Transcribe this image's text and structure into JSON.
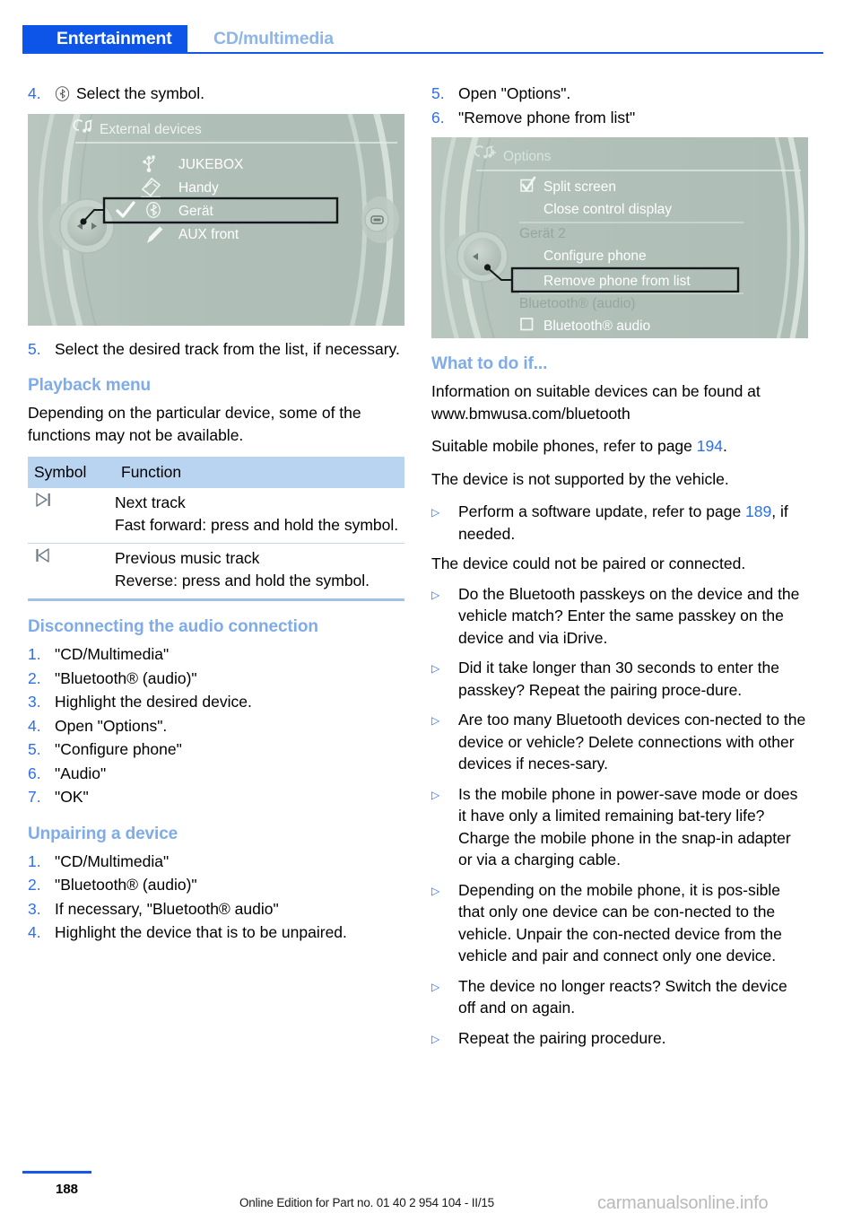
{
  "header": {
    "tab_active": "Entertainment",
    "tab_inactive": "CD/multimedia"
  },
  "left": {
    "step4": {
      "num": "4.",
      "icon": "bluetooth-circle-icon",
      "text": "Select the symbol."
    },
    "screenshot1": {
      "name": "external-devices-idrive-screen",
      "title": "External devices",
      "title_icon": "music-note-device-icon",
      "items": [
        {
          "label": "JUKEBOX",
          "icon": "usb-icon",
          "checked": false,
          "highlighted": false
        },
        {
          "label": "Handy",
          "icon": "handheld-device-icon",
          "checked": false,
          "highlighted": false
        },
        {
          "label": "Gerät",
          "icon": "bluetooth-icon",
          "checked": true,
          "highlighted": true
        },
        {
          "label": "AUX front",
          "icon": "aux-plug-icon",
          "checked": false,
          "highlighted": false
        }
      ]
    },
    "step5": {
      "num": "5.",
      "text": "Select the desired track from the list, if necessary."
    },
    "playback": {
      "heading": "Playback menu",
      "intro": "Depending on the particular device, some of the functions may not be available.",
      "table": {
        "headers": [
          "Symbol",
          "Function"
        ],
        "rows": [
          {
            "symbol_icon": "next-track-icon",
            "lines": [
              "Next track",
              "Fast forward: press and hold the symbol."
            ]
          },
          {
            "symbol_icon": "previous-track-icon",
            "lines": [
              "Previous music track",
              "Reverse: press and hold the symbol."
            ]
          }
        ]
      }
    },
    "disconnecting": {
      "heading": "Disconnecting the audio connection",
      "steps": [
        {
          "num": "1.",
          "text": "\"CD/Multimedia\""
        },
        {
          "num": "2.",
          "text": "\"Bluetooth® (audio)\""
        },
        {
          "num": "3.",
          "text": "Highlight the desired device."
        },
        {
          "num": "4.",
          "text": "Open \"Options\"."
        },
        {
          "num": "5.",
          "text": "\"Configure phone\""
        },
        {
          "num": "6.",
          "text": "\"Audio\""
        },
        {
          "num": "7.",
          "text": "\"OK\""
        }
      ]
    },
    "unpairing": {
      "heading": "Unpairing a device",
      "steps": [
        {
          "num": "1.",
          "text": "\"CD/Multimedia\""
        },
        {
          "num": "2.",
          "text": "\"Bluetooth® (audio)\""
        },
        {
          "num": "3.",
          "text": "If necessary, \"Bluetooth® audio\""
        },
        {
          "num": "4.",
          "text": "Highlight the device that is to be unpaired."
        }
      ]
    }
  },
  "right": {
    "steps_top": [
      {
        "num": "5.",
        "text": "Open \"Options\"."
      },
      {
        "num": "6.",
        "text": "\"Remove phone from list\""
      }
    ],
    "screenshot2": {
      "name": "options-idrive-screen",
      "title": "Options",
      "title_icon": "options-music-icon",
      "items": [
        {
          "label": "Split screen",
          "box": "checked",
          "dim": false,
          "highlighted": false
        },
        {
          "label": "Close control display",
          "box": "none",
          "dim": false,
          "highlighted": false
        },
        {
          "label": "Gerät 2",
          "box": "none",
          "dim": true,
          "highlighted": false
        },
        {
          "label": "Configure phone",
          "box": "none",
          "dim": false,
          "highlighted": false
        },
        {
          "label": "Remove phone from list",
          "box": "none",
          "dim": false,
          "highlighted": true
        },
        {
          "label": "Bluetooth® (audio)",
          "box": "none",
          "dim": true,
          "highlighted": false
        },
        {
          "label": "Bluetooth® audio",
          "box": "unchecked",
          "dim": false,
          "highlighted": false
        }
      ]
    },
    "whattodo": {
      "heading": "What to do if...",
      "paras": [
        "Information on suitable devices can be found at www.bmwusa.com/bluetooth"
      ],
      "ref_line": {
        "before": "Suitable mobile phones, refer to page ",
        "page": "194",
        "after": "."
      },
      "case1": "The device is not supported by the vehicle.",
      "case1_bullet": {
        "before": "Perform a software update, refer to page ",
        "page": "189",
        "after": ", if needed."
      },
      "case2": "The device could not be paired or connected.",
      "bullets": [
        "Do the Bluetooth passkeys on the device and the vehicle match? Enter the same passkey on the device and via iDrive.",
        "Did it take longer than 30 seconds to enter the passkey? Repeat the pairing proce-dure.",
        "Are too many Bluetooth devices con-nected to the device or vehicle? Delete connections with other devices if neces-sary.",
        "Is the mobile phone in power-save mode or does it have only a limited remaining bat-tery life? Charge the mobile phone in the snap-in adapter or via a charging cable.",
        "Depending on the mobile phone, it is pos-sible that only one device can be con-nected to the vehicle. Unpair the con-nected device from the vehicle and pair and connect only one device.",
        "The device no longer reacts? Switch the device off and on again.",
        "Repeat the pairing procedure."
      ],
      "bullet_mark": "triangle-right-bullet"
    }
  },
  "footer": {
    "page_number": "188",
    "edition": "Online Edition for Part no. 01 40 2 954 104 - II/15",
    "watermark": "carmanualsonline.info"
  },
  "colors": {
    "accent_blue": "#0d55e8",
    "heading_blue": "#7fabe8",
    "link_blue": "#2e6fe8",
    "table_header": "#b9d4f0",
    "idrive_bg": "#b3c2bb"
  }
}
